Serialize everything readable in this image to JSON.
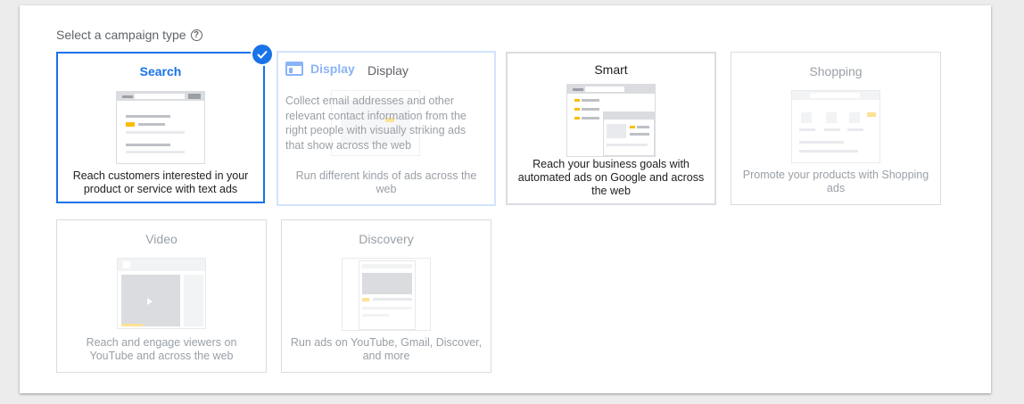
{
  "heading": {
    "label": "Select a campaign type",
    "help_icon": "help-circle-icon"
  },
  "colors": {
    "accent": "#1a73e8",
    "text": "#202124",
    "muted": "#9aa0a6",
    "highlight": "#fbbc04"
  },
  "cards": {
    "search": {
      "title": "Search",
      "description": "Reach customers interested in your product or service with text ads",
      "selected": true
    },
    "display": {
      "title": "Display",
      "hover_title": "Display",
      "hover_text": "Collect email addresses and other relevant contact information from the right people with visually striking ads that show across the web",
      "description": "Run different kinds of ads across the web"
    },
    "smart": {
      "title": "Smart",
      "description": "Reach your business goals with automated ads on Google and across the web"
    },
    "shopping": {
      "title": "Shopping",
      "description": "Promote your products with Shopping ads",
      "disabled": true
    },
    "video": {
      "title": "Video",
      "description": "Reach and engage viewers on YouTube and across the web",
      "disabled": true
    },
    "discovery": {
      "title": "Discovery",
      "description": "Run ads on YouTube, Gmail, Discover, and more",
      "disabled": true
    }
  }
}
